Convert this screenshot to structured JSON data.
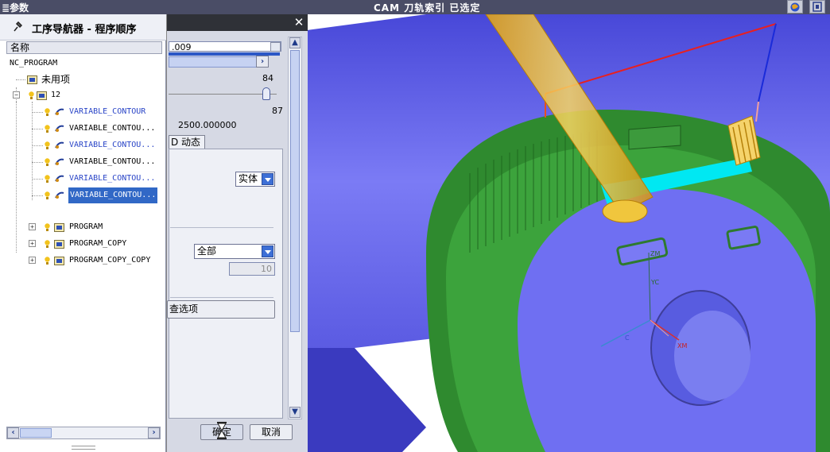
{
  "topbar": {
    "left_text": "≣参数",
    "status": "CAM 刀轨索引 已选定"
  },
  "navigator": {
    "title": "工序导航器 - 程序顺序",
    "column_header": "名称",
    "items": [
      {
        "label": "NC_PROGRAM"
      },
      {
        "label": "未用项"
      },
      {
        "label": "12"
      },
      {
        "label": "VARIABLE_CONTOUR"
      },
      {
        "label": "VARIABLE_CONTOU..."
      },
      {
        "label": "VARIABLE_CONTOU..."
      },
      {
        "label": "VARIABLE_CONTOU..."
      },
      {
        "label": "VARIABLE_CONTOU..."
      },
      {
        "label": "VARIABLE_CONTOU..."
      },
      {
        "label": "PROGRAM"
      },
      {
        "label": "PROGRAM_COPY"
      },
      {
        "label": "PROGRAM_COPY_COPY"
      }
    ]
  },
  "dialog": {
    "field_top_value": ".009",
    "slider_top_value": "84",
    "slider_bottom_value": "87",
    "speed_value": "2500.000000",
    "tab_label": "D 动态",
    "display_dropdown": "实体",
    "range_dropdown": "全部",
    "count_value": "10",
    "options_button": "查选项",
    "ok_button": "确定",
    "cancel_button": "取消"
  },
  "colors": {
    "part_blue": "#6f6ff2",
    "part_green": "#2f8a2f",
    "highlight_cyan": "#00e8f2",
    "tool_orange": "#e8a818",
    "selection_blue": "#3168c6"
  },
  "axes": {
    "zm": "ZM",
    "yc": "YC",
    "xm": "XM",
    "c": "C"
  }
}
